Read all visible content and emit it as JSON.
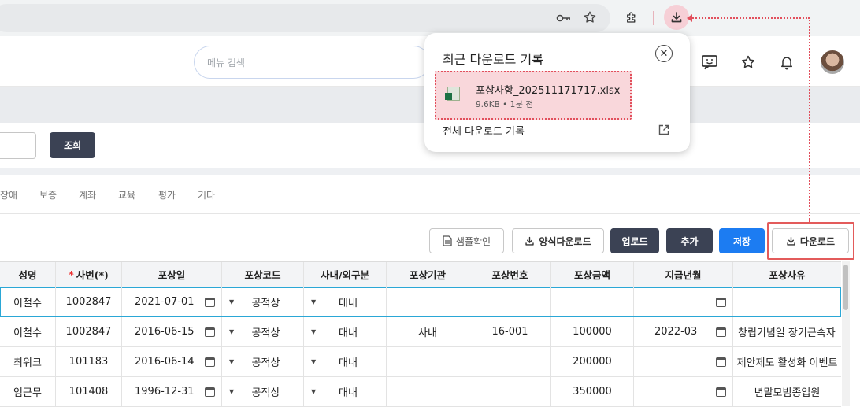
{
  "header": {
    "menu_search_placeholder": "메뉴 검색"
  },
  "filter": {
    "search_button": "조회"
  },
  "tabs": [
    "장애",
    "보증",
    "계좌",
    "교육",
    "평가",
    "기타"
  ],
  "toolbar": {
    "sample_check": "샘플확인",
    "template_download": "양식다운로드",
    "upload": "업로드",
    "add": "추가",
    "save": "저장",
    "download": "다운로드"
  },
  "table": {
    "columns": [
      "성명",
      "사번(*)",
      "포상일",
      "포상코드",
      "사내/외구분",
      "포상기관",
      "포상번호",
      "포상금액",
      "지급년월",
      "포상사유"
    ],
    "required_marker": "*",
    "rows": [
      {
        "name": "이철수",
        "emp_no": "1002847",
        "date": "2021-07-01",
        "code": "공적상",
        "type": "대내",
        "org": "",
        "num": "",
        "amount": "",
        "pay_month": "",
        "reason": ""
      },
      {
        "name": "이철수",
        "emp_no": "1002847",
        "date": "2016-06-15",
        "code": "공적상",
        "type": "대내",
        "org": "사내",
        "num": "16-001",
        "amount": "100000",
        "pay_month": "2022-03",
        "reason": "창립기념일 장기근속자"
      },
      {
        "name": "최워크",
        "emp_no": "101183",
        "date": "2016-06-14",
        "code": "공적상",
        "type": "대내",
        "org": "",
        "num": "",
        "amount": "200000",
        "pay_month": "",
        "reason": "제안제도 활성화 이벤트"
      },
      {
        "name": "엄근무",
        "emp_no": "101408",
        "date": "1996-12-31",
        "code": "공적상",
        "type": "대내",
        "org": "",
        "num": "",
        "amount": "350000",
        "pay_month": "",
        "reason": "년말모범종업원"
      }
    ]
  },
  "download_popup": {
    "title": "최근 다운로드 기록",
    "file_name": "포상사항_202511171717.xlsx",
    "file_meta": "9.6KB • 1분 전",
    "all_history": "전체 다운로드 기록"
  },
  "colors": {
    "accent_blue": "#1c7cf2",
    "dark_button": "#3b4254",
    "highlight_red": "#e24f5c"
  }
}
